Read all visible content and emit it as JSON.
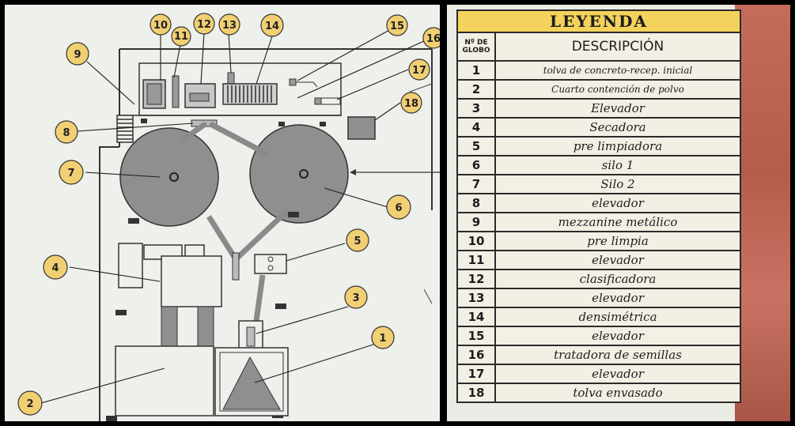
{
  "plan": {
    "balloons": [
      {
        "label": "1"
      },
      {
        "label": "2"
      },
      {
        "label": "3"
      },
      {
        "label": "4"
      },
      {
        "label": "5"
      },
      {
        "label": "6"
      },
      {
        "label": "7"
      },
      {
        "label": "8"
      },
      {
        "label": "9"
      },
      {
        "label": "10"
      },
      {
        "label": "11"
      },
      {
        "label": "12"
      },
      {
        "label": "13"
      },
      {
        "label": "14"
      },
      {
        "label": "15"
      },
      {
        "label": "16"
      },
      {
        "label": "17"
      },
      {
        "label": "18"
      }
    ],
    "colors": {
      "paper": "#eef0ec",
      "equipment": "#8f8f8f",
      "balloon": "#f1cf73",
      "line": "#2a2a2a"
    }
  },
  "legend": {
    "title": "LEYENDA",
    "col_num": "Nº DE GLOBO",
    "col_desc": "DESCRIPCIÓN",
    "rows": [
      {
        "num": "1",
        "desc": "tolva de concreto-recep. inicial"
      },
      {
        "num": "2",
        "desc": "Cuarto contención de polvo"
      },
      {
        "num": "3",
        "desc": "Elevador"
      },
      {
        "num": "4",
        "desc": "Secadora"
      },
      {
        "num": "5",
        "desc": "pre limpiadora"
      },
      {
        "num": "6",
        "desc": "silo 1"
      },
      {
        "num": "7",
        "desc": "Silo 2"
      },
      {
        "num": "8",
        "desc": "elevador"
      },
      {
        "num": "9",
        "desc": "mezzanine metálico"
      },
      {
        "num": "10",
        "desc": "pre limpia"
      },
      {
        "num": "11",
        "desc": "elevador"
      },
      {
        "num": "12",
        "desc": "clasificadora"
      },
      {
        "num": "13",
        "desc": "elevador"
      },
      {
        "num": "14",
        "desc": "densimétrica"
      },
      {
        "num": "15",
        "desc": "elevador"
      },
      {
        "num": "16",
        "desc": "tratadora de semillas"
      },
      {
        "num": "17",
        "desc": "elevador"
      },
      {
        "num": "18",
        "desc": "tolva envasado"
      }
    ],
    "colors": {
      "title_bg": "#f4d35c",
      "table_bg": "#f2f0e4"
    }
  }
}
